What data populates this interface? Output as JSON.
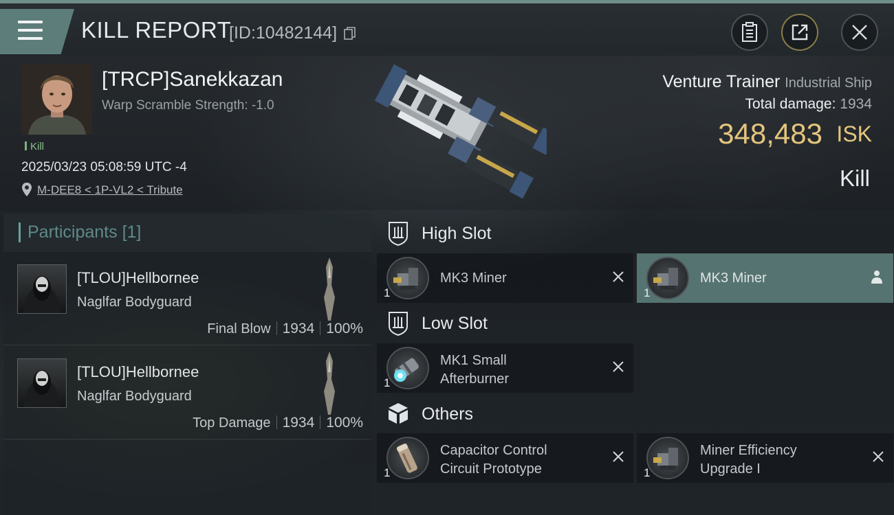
{
  "header": {
    "title": "KILL REPORT",
    "report_id": "[ID:10482144]"
  },
  "victim": {
    "name": "[TRCP]Sanekkazan",
    "warp_scramble": "Warp Scramble Strength: -1.0",
    "tag": "Kill",
    "datetime": "2025/03/23 05:08:59 UTC -4",
    "location": "M-DEE8 < 1P-VL2 < Tribute"
  },
  "ship": {
    "name": "Venture Trainer",
    "class": "Industrial Ship",
    "total_damage_label": "Total damage:",
    "total_damage": "1934",
    "isk_value": "348,483",
    "isk_unit": "ISK",
    "result": "Kill"
  },
  "participants": {
    "title": "Participants",
    "count": "[1]",
    "rows": [
      {
        "name": "[TLOU]Hellbornee",
        "ship": "Naglfar Bodyguard",
        "role": "Final Blow",
        "damage": "1934",
        "percent": "100%"
      },
      {
        "name": "[TLOU]Hellbornee",
        "ship": "Naglfar Bodyguard",
        "role": "Top Damage",
        "damage": "1934",
        "percent": "100%"
      }
    ]
  },
  "fitting": {
    "high_slot": {
      "label": "High Slot",
      "modules": [
        {
          "name": "MK3 Miner",
          "qty": "1",
          "status": "destroyed",
          "icon": "miner-icon"
        },
        {
          "name": "MK3 Miner",
          "qty": "1",
          "status": "dropped",
          "icon": "miner-icon"
        }
      ]
    },
    "low_slot": {
      "label": "Low Slot",
      "modules": [
        {
          "name_line1": "MK1 Small",
          "name_line2": "Afterburner",
          "qty": "1",
          "status": "destroyed",
          "icon": "afterburner-icon"
        }
      ]
    },
    "others": {
      "label": "Others",
      "modules": [
        {
          "name_line1": "Capacitor Control",
          "name_line2": "Circuit Prototype",
          "qty": "1",
          "status": "destroyed",
          "icon": "capacitor-icon"
        },
        {
          "name_line1": "Miner Efficiency",
          "name_line2": "Upgrade I",
          "qty": "1",
          "status": "destroyed",
          "icon": "miner-upgrade-icon"
        }
      ]
    }
  },
  "colors": {
    "accent": "#5d7d7b",
    "isk": "#e4c57d",
    "kill_tag": "#8dbd8d",
    "active_slot": "#557371"
  }
}
